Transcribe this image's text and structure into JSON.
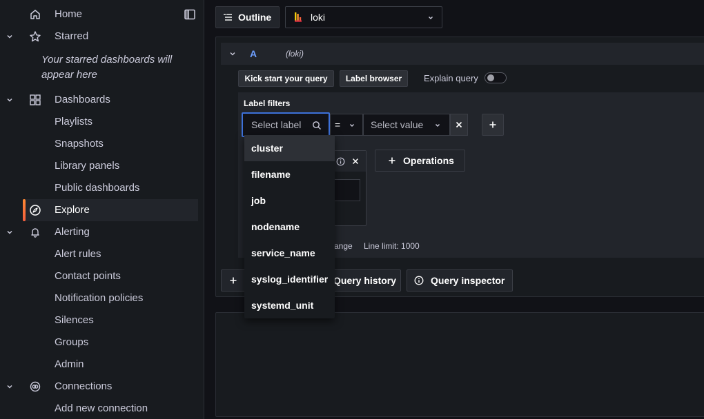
{
  "sidebar": {
    "items": [
      {
        "label": "Home",
        "icon": "home-icon",
        "chevron": false
      },
      {
        "label": "Starred",
        "icon": "star-icon",
        "chevron": true
      },
      {
        "label": "Dashboards",
        "icon": "grid-icon",
        "chevron": true
      },
      {
        "label": "Playlists"
      },
      {
        "label": "Snapshots"
      },
      {
        "label": "Library panels"
      },
      {
        "label": "Public dashboards"
      },
      {
        "label": "Explore",
        "icon": "compass-icon",
        "active": true
      },
      {
        "label": "Alerting",
        "icon": "bell-icon",
        "chevron": true
      },
      {
        "label": "Alert rules"
      },
      {
        "label": "Contact points"
      },
      {
        "label": "Notification policies"
      },
      {
        "label": "Silences"
      },
      {
        "label": "Groups"
      },
      {
        "label": "Admin"
      },
      {
        "label": "Connections",
        "icon": "connections-icon",
        "chevron": true
      },
      {
        "label": "Add new connection"
      }
    ],
    "starred_empty": "Your starred dashboards will appear here"
  },
  "toolbar": {
    "outline_label": "Outline",
    "datasource": "loki"
  },
  "query": {
    "name": "A",
    "datasource_tag": "(loki)",
    "kick_start_label": "Kick start your query",
    "label_browser_label": "Label browser",
    "explain_label": "Explain query",
    "explain_enabled": false,
    "filters_title": "Label filters",
    "label_placeholder": "Select label",
    "operator": "=",
    "value_placeholder": "Select value",
    "operations_label": "Operations",
    "options_fragment": "ange",
    "line_limit": "Line limit: 1000"
  },
  "dropdown": {
    "options": [
      "cluster",
      "filename",
      "job",
      "nodename",
      "service_name",
      "syslog_identifier",
      "systemd_unit"
    ],
    "highlighted": "cluster"
  },
  "bottom": {
    "query_history_label": "Query history",
    "query_inspector_label": "Query inspector"
  },
  "colors": {
    "accent": "#3d71d9",
    "active_bar": "#ff8833",
    "query_name": "#6e9fff"
  }
}
